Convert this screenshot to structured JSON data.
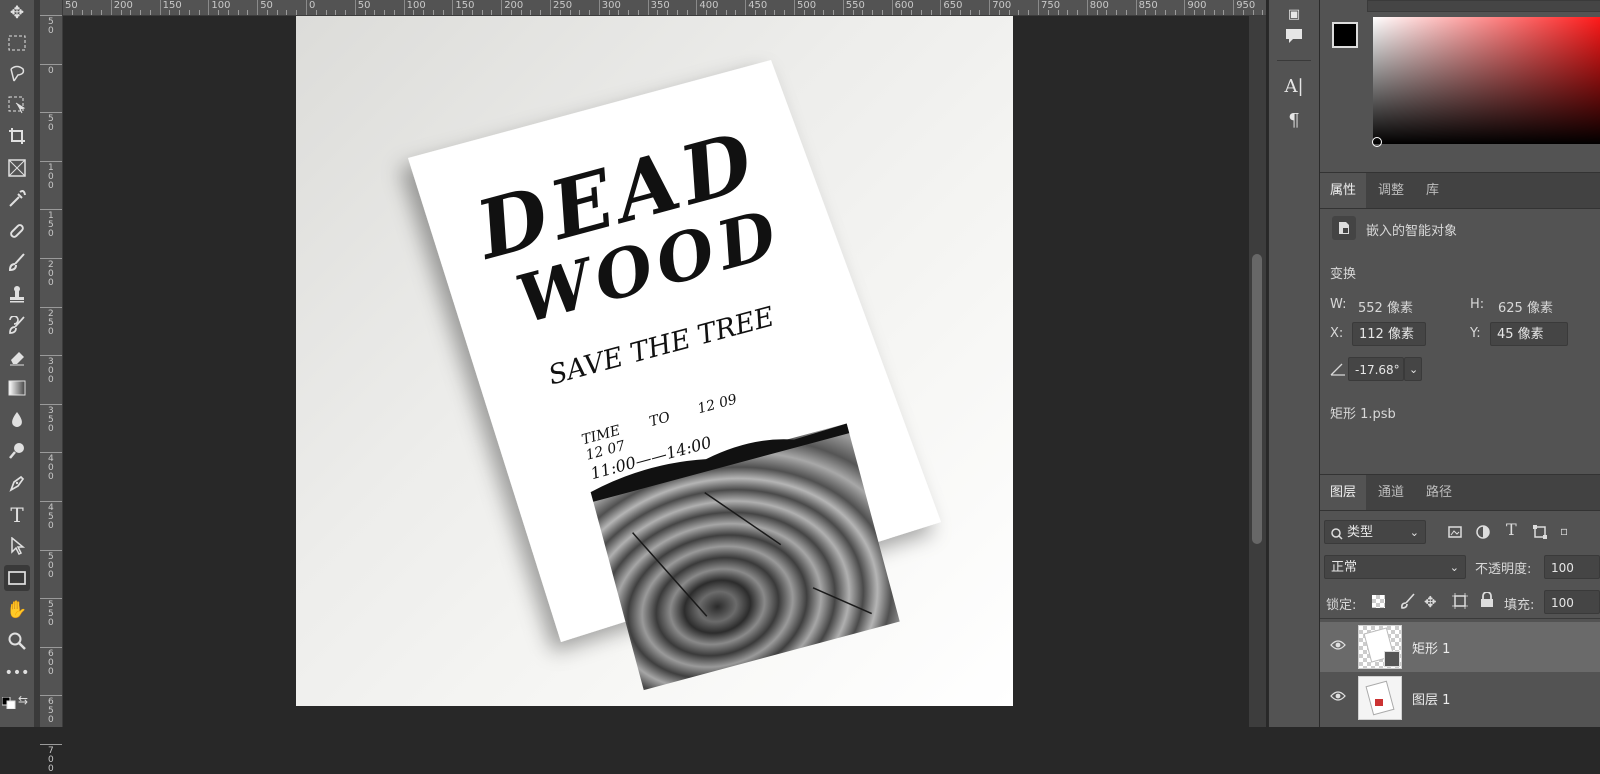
{
  "ruler": {
    "h_labels": [
      "50",
      "200",
      "150",
      "100",
      "50",
      "0",
      "50",
      "100",
      "150",
      "200",
      "250",
      "300",
      "350",
      "400",
      "450",
      "500",
      "550",
      "600",
      "650",
      "700",
      "750",
      "800",
      "850",
      "900",
      "950"
    ],
    "v_labels": [
      "5 0",
      "0",
      "5 0",
      "1 0 0",
      "1 5 0",
      "2 0 0",
      "2 5 0",
      "3 0 0",
      "3 5 0",
      "4 0 0",
      "4 5 0",
      "5 0 0",
      "5 5 0",
      "6 0 0",
      "6 5 0",
      "7 0 0"
    ]
  },
  "poster": {
    "title_line1": "DEAD",
    "title_line2": "WOOD",
    "subtitle": "SAVE THE TREE",
    "time_label": "TIME",
    "date_from": "12 07",
    "date_to_word": "TO",
    "date_to": "12 09",
    "hours": "11:00——14:00"
  },
  "properties": {
    "tabs": [
      "属性",
      "调整",
      "库"
    ],
    "object_type": "嵌入的智能对象",
    "transform_label": "变换",
    "w_label": "W:",
    "w_value": "552 像素",
    "h_label": "H:",
    "h_value": "625 像素",
    "x_label": "X:",
    "x_value": "112 像素",
    "y_label": "Y:",
    "y_value": "45 像素",
    "angle_value": "-17.68°",
    "filename": "矩形 1.psb"
  },
  "layers": {
    "tabs": [
      "图层",
      "通道",
      "路径"
    ],
    "filter_kind": "类型",
    "blend_mode": "正常",
    "opacity_label": "不透明度:",
    "opacity_value": "100",
    "lock_label": "锁定:",
    "fill_label": "填充:",
    "fill_value": "100",
    "items": [
      {
        "name": "矩形 1"
      },
      {
        "name": "图层 1"
      }
    ]
  },
  "colors": {
    "foreground": "#000000",
    "background": "#ffffff",
    "accent_red": "#ff1a1a"
  },
  "icons": {
    "tools": [
      "move-icon",
      "marquee-icon",
      "lasso-icon",
      "object-select-icon",
      "crop-icon",
      "frame-icon",
      "eyedropper-icon",
      "healing-icon",
      "brush-icon",
      "stamp-icon",
      "history-brush-icon",
      "eraser-icon",
      "gradient-icon",
      "blur-icon",
      "dodge-icon",
      "pen-icon",
      "type-icon",
      "path-select-icon",
      "rectangle-icon",
      "hand-icon",
      "zoom-icon",
      "more-icon"
    ]
  }
}
